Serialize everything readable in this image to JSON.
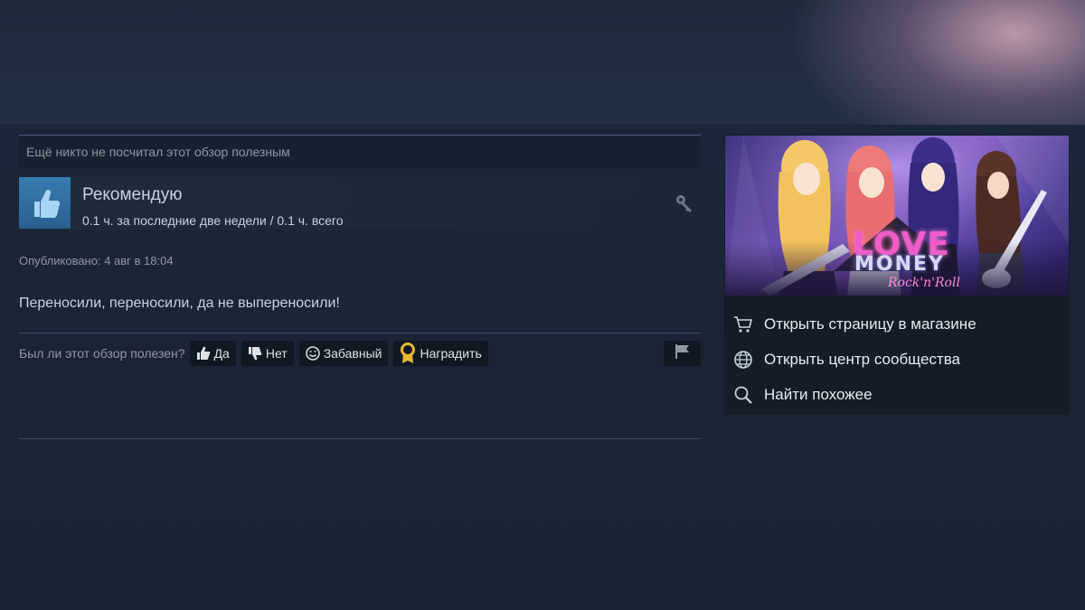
{
  "review": {
    "helpful_status": "Ещё никто не посчитал этот обзор полезным",
    "recommendation": "Рекомендую",
    "hours": "0.1 ч. за последние две недели / 0.1 ч. всего",
    "posted": "Опубликовано: 4 авг в 18:04",
    "text": "Переносили, переносили, да не выпереносили!",
    "vote_question": "Был ли этот обзор полезен?",
    "buttons": {
      "yes": "Да",
      "no": "Нет",
      "funny": "Забавный",
      "award": "Наградить"
    }
  },
  "game": {
    "logo_line1": "LOVE",
    "logo_line2": "MONEY",
    "logo_line3": "Rock'n'Roll"
  },
  "sidebar_menu": [
    {
      "label": "Открыть страницу в магазине",
      "icon": "cart-icon"
    },
    {
      "label": "Открыть центр сообщества",
      "icon": "globe-icon"
    },
    {
      "label": "Найти похожее",
      "icon": "search-icon"
    }
  ],
  "colors": {
    "background": "#1b2434",
    "recommend_thumb": "#3a7bb0",
    "text_primary": "#c6d4df",
    "text_muted": "#8f98a0",
    "award": "#e8b832"
  }
}
